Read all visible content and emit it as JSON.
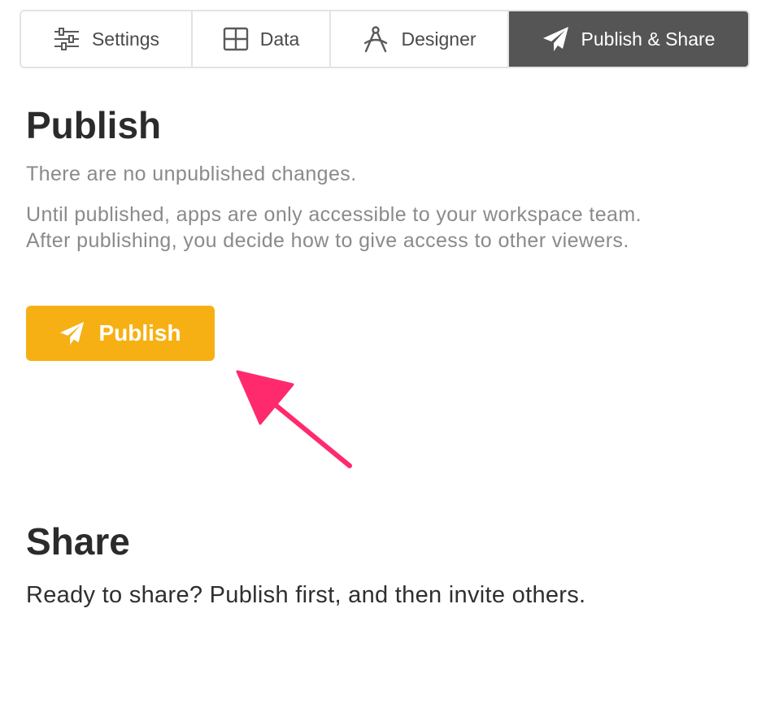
{
  "tabs": [
    {
      "label": "Settings",
      "icon": "sliders-icon"
    },
    {
      "label": "Data",
      "icon": "grid-icon"
    },
    {
      "label": "Designer",
      "icon": "compass-icon"
    },
    {
      "label": "Publish & Share",
      "icon": "paper-plane-icon",
      "active": true
    }
  ],
  "publish": {
    "heading": "Publish",
    "status": "There are no unpublished changes.",
    "description_line1": "Until published, apps are only accessible to your workspace team.",
    "description_line2": "After publishing, you decide how to give access to other viewers.",
    "button_label": "Publish",
    "button_icon": "paper-plane-icon"
  },
  "share": {
    "heading": "Share",
    "text": "Ready to share? Publish first, and then invite others."
  },
  "colors": {
    "accent": "#f7b013",
    "active_tab": "#555555",
    "annotation_arrow": "#ff2a6d"
  }
}
